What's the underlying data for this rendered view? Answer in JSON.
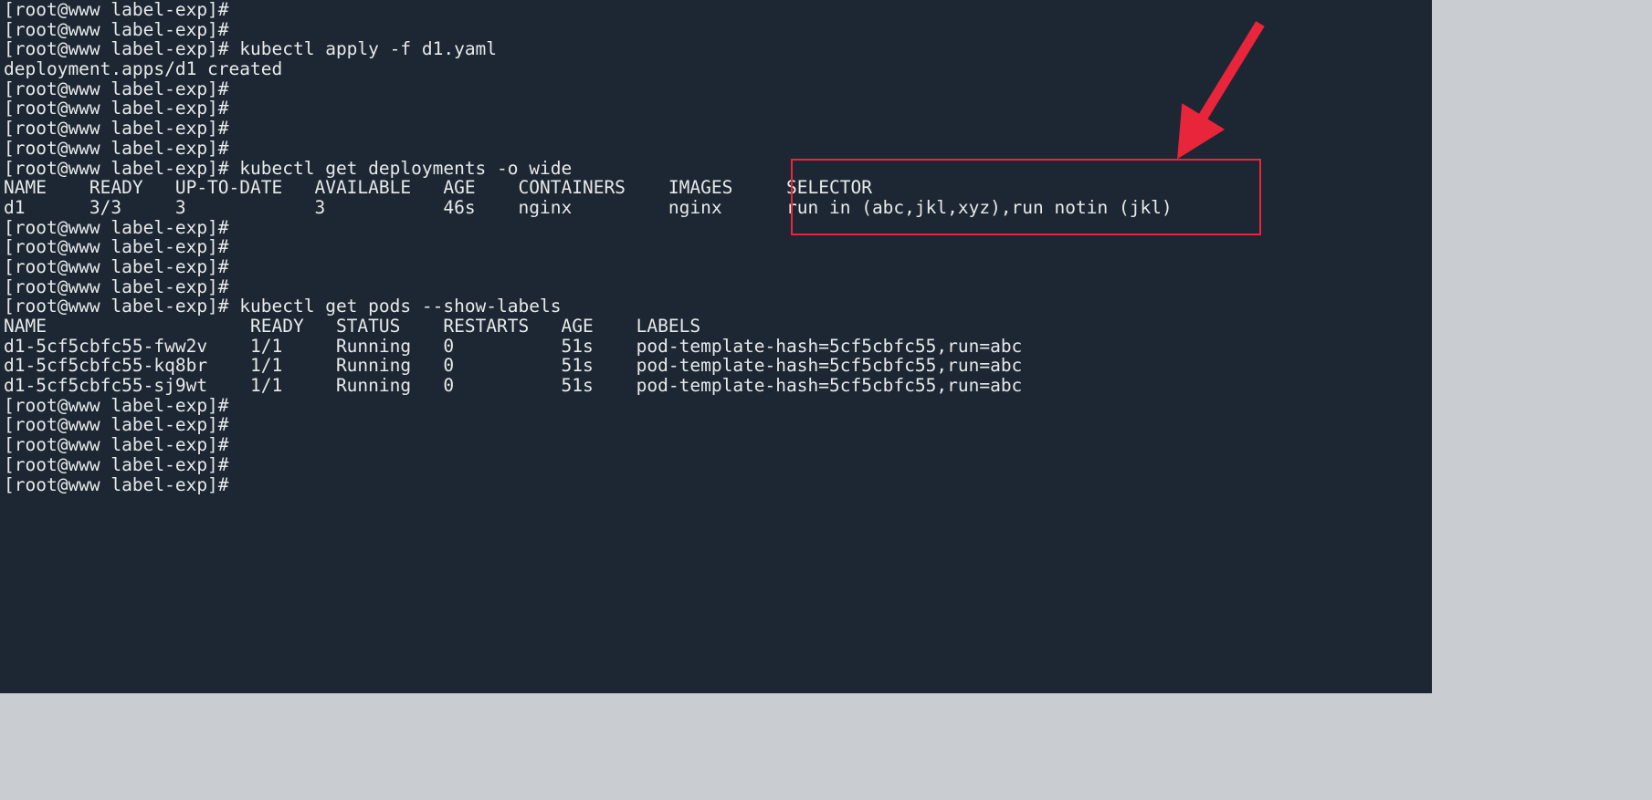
{
  "terminal": {
    "prompt": "[root@www label-exp]#",
    "background_color": "#1d2733",
    "foreground_color": "#e7e9ea",
    "lines": [
      "[root@www label-exp]#",
      "[root@www label-exp]#",
      "[root@www label-exp]# kubectl apply -f d1.yaml",
      "deployment.apps/d1 created",
      "[root@www label-exp]#",
      "[root@www label-exp]#",
      "[root@www label-exp]#",
      "[root@www label-exp]#",
      "[root@www label-exp]# kubectl get deployments -o wide",
      "NAME    READY   UP-TO-DATE   AVAILABLE   AGE    CONTAINERS    IMAGES     SELECTOR",
      "d1      3/3     3            3           46s    nginx         nginx      run in (abc,jkl,xyz),run notin (jkl)",
      "[root@www label-exp]#",
      "[root@www label-exp]#",
      "[root@www label-exp]#",
      "[root@www label-exp]#",
      "[root@www label-exp]# kubectl get pods --show-labels",
      "NAME                   READY   STATUS    RESTARTS   AGE    LABELS",
      "d1-5cf5cbfc55-fww2v    1/1     Running   0          51s    pod-template-hash=5cf5cbfc55,run=abc",
      "d1-5cf5cbfc55-kq8br    1/1     Running   0          51s    pod-template-hash=5cf5cbfc55,run=abc",
      "d1-5cf5cbfc55-sj9wt    1/1     Running   0          51s    pod-template-hash=5cf5cbfc55,run=abc",
      "[root@www label-exp]#",
      "[root@www label-exp]#",
      "[root@www label-exp]#",
      "[root@www label-exp]#",
      "[root@www label-exp]#"
    ]
  },
  "commands": {
    "apply": "kubectl apply -f d1.yaml",
    "apply_output": "deployment.apps/d1 created",
    "get_deployments": "kubectl get deployments -o wide",
    "get_pods": "kubectl get pods --show-labels"
  },
  "deployments_table": {
    "headers": [
      "NAME",
      "READY",
      "UP-TO-DATE",
      "AVAILABLE",
      "AGE",
      "CONTAINERS",
      "IMAGES",
      "SELECTOR"
    ],
    "rows": [
      {
        "name": "d1",
        "ready": "3/3",
        "up_to_date": "3",
        "available": "3",
        "age": "46s",
        "containers": "nginx",
        "images": "nginx",
        "selector": "run in (abc,jkl,xyz),run notin (jkl)"
      }
    ]
  },
  "pods_table": {
    "headers": [
      "NAME",
      "READY",
      "STATUS",
      "RESTARTS",
      "AGE",
      "LABELS"
    ],
    "rows": [
      {
        "name": "d1-5cf5cbfc55-fww2v",
        "ready": "1/1",
        "status": "Running",
        "restarts": "0",
        "age": "51s",
        "labels": "pod-template-hash=5cf5cbfc55,run=abc"
      },
      {
        "name": "d1-5cf5cbfc55-kq8br",
        "ready": "1/1",
        "status": "Running",
        "restarts": "0",
        "age": "51s",
        "labels": "pod-template-hash=5cf5cbfc55,run=abc"
      },
      {
        "name": "d1-5cf5cbfc55-sj9wt",
        "ready": "1/1",
        "status": "Running",
        "restarts": "0",
        "age": "51s",
        "labels": "pod-template-hash=5cf5cbfc55,run=abc"
      }
    ]
  },
  "annotations": {
    "highlight_color": "#e8253a",
    "highlight_target": "SELECTOR",
    "arrow_color": "#e8253a"
  }
}
